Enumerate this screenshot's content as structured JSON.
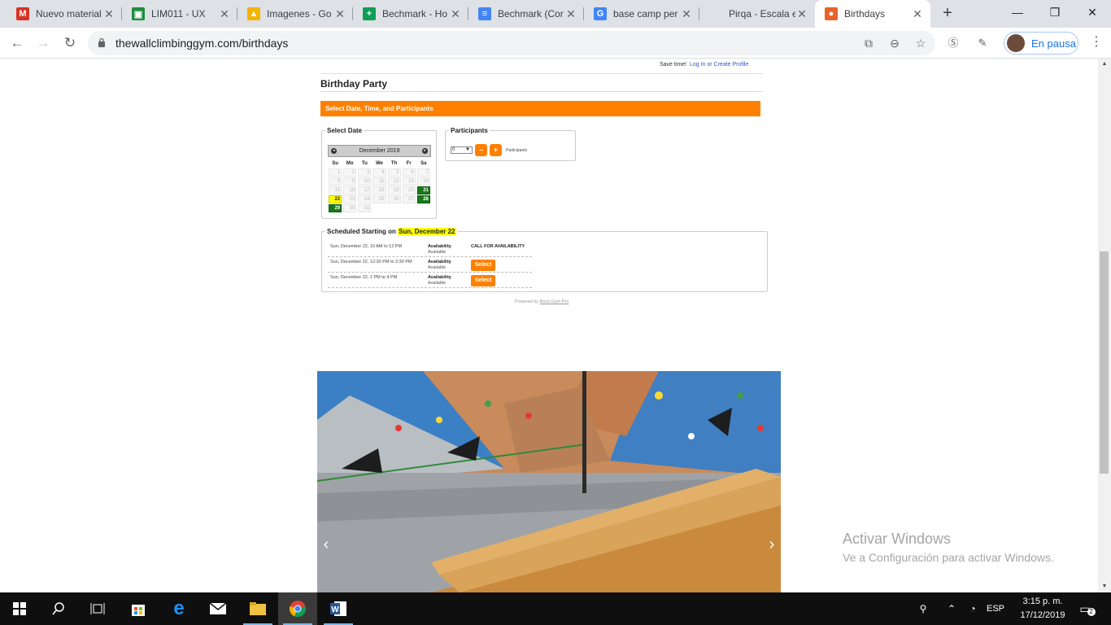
{
  "browser": {
    "tabs": [
      {
        "title": "Nuevo material",
        "icon": "gmail-icon",
        "color": "#d93025",
        "glyph": "M"
      },
      {
        "title": "LIM011 - UX",
        "icon": "classroom-icon",
        "color": "#1e8e3e",
        "glyph": "▣"
      },
      {
        "title": "Imagenes - Go",
        "icon": "drive-icon",
        "color": "#f4b400",
        "glyph": "▲"
      },
      {
        "title": "Bechmark - Ho",
        "icon": "sheets-icon",
        "color": "#0f9d58",
        "glyph": "+"
      },
      {
        "title": "Bechmark (Cor",
        "icon": "docs-icon",
        "color": "#4285f4",
        "glyph": "≡"
      },
      {
        "title": "base camp per",
        "icon": "google-icon",
        "color": "#4285f4",
        "glyph": "G"
      },
      {
        "title": "Pirqa - Escala e",
        "icon": "blank-icon",
        "color": "#dee1e6",
        "glyph": ""
      },
      {
        "title": "Birthdays",
        "icon": "site-icon",
        "color": "#e8622c",
        "glyph": "●",
        "active": true
      }
    ],
    "url": "thewallclimbinggym.com/birthdays",
    "profile_label": "En pausa"
  },
  "page": {
    "save_time": "Save time!",
    "login_link": "Log In or Create Profile",
    "title": "Birthday Party",
    "section_bar": "Select Date, Time, and Participants",
    "select_date_legend": "Select Date",
    "participants_legend": "Participants",
    "calendar": {
      "month": "December 2019",
      "dow": [
        "Su",
        "Mo",
        "Tu",
        "We",
        "Th",
        "Fr",
        "Sa"
      ],
      "weeks": [
        [
          {
            "d": "1"
          },
          {
            "d": "2"
          },
          {
            "d": "3"
          },
          {
            "d": "4"
          },
          {
            "d": "5"
          },
          {
            "d": "6"
          },
          {
            "d": "7"
          }
        ],
        [
          {
            "d": "8"
          },
          {
            "d": "9"
          },
          {
            "d": "10"
          },
          {
            "d": "11"
          },
          {
            "d": "12"
          },
          {
            "d": "13"
          },
          {
            "d": "14"
          }
        ],
        [
          {
            "d": "15"
          },
          {
            "d": "16"
          },
          {
            "d": "17"
          },
          {
            "d": "18"
          },
          {
            "d": "19"
          },
          {
            "d": "20"
          },
          {
            "d": "21",
            "s": "avail"
          }
        ],
        [
          {
            "d": "22",
            "s": "sel"
          },
          {
            "d": "23"
          },
          {
            "d": "24"
          },
          {
            "d": "25"
          },
          {
            "d": "26"
          },
          {
            "d": "27"
          },
          {
            "d": "28",
            "s": "avail"
          }
        ],
        [
          {
            "d": "29",
            "s": "avail"
          },
          {
            "d": "30"
          },
          {
            "d": "31"
          },
          {
            "d": "",
            "s": "empty"
          },
          {
            "d": "",
            "s": "empty"
          },
          {
            "d": "",
            "s": "empty"
          },
          {
            "d": "",
            "s": "empty"
          }
        ]
      ]
    },
    "participants": {
      "value": "0",
      "minus": "–",
      "plus": "+",
      "label": "Participants"
    },
    "schedule": {
      "prefix": "Scheduled Starting on",
      "date": "Sun, December 22",
      "rows": [
        {
          "when": "Sun, December 22, 10 AM to 12 PM",
          "avail_key": "Availability",
          "avail_val": "Available",
          "action": "CALL FOR AVAILABILITY",
          "type": "text"
        },
        {
          "when": "Sun, December 22, 12:30 PM to 2:30 PM",
          "avail_key": "Availability",
          "avail_val": "Available",
          "action": "Select",
          "type": "button"
        },
        {
          "when": "Sun, December 22, 2 PM to 4 PM",
          "avail_key": "Availability",
          "avail_val": "Available",
          "action": "Select",
          "type": "button"
        }
      ]
    },
    "powered_prefix": "Powered by",
    "powered_link": "Rock Gym Pro",
    "carousel": {
      "prev": "‹",
      "next": "›"
    }
  },
  "watermark": {
    "line1": "Activar Windows",
    "line2": "Ve a Configuración para activar Windows."
  },
  "taskbar": {
    "lang": "ESP",
    "time": "3:15 p. m.",
    "date": "17/12/2019",
    "notif_count": "2"
  },
  "colors": {
    "accent": "#ff8000",
    "available": "#1a7a1a",
    "selected": "#ffff00"
  }
}
